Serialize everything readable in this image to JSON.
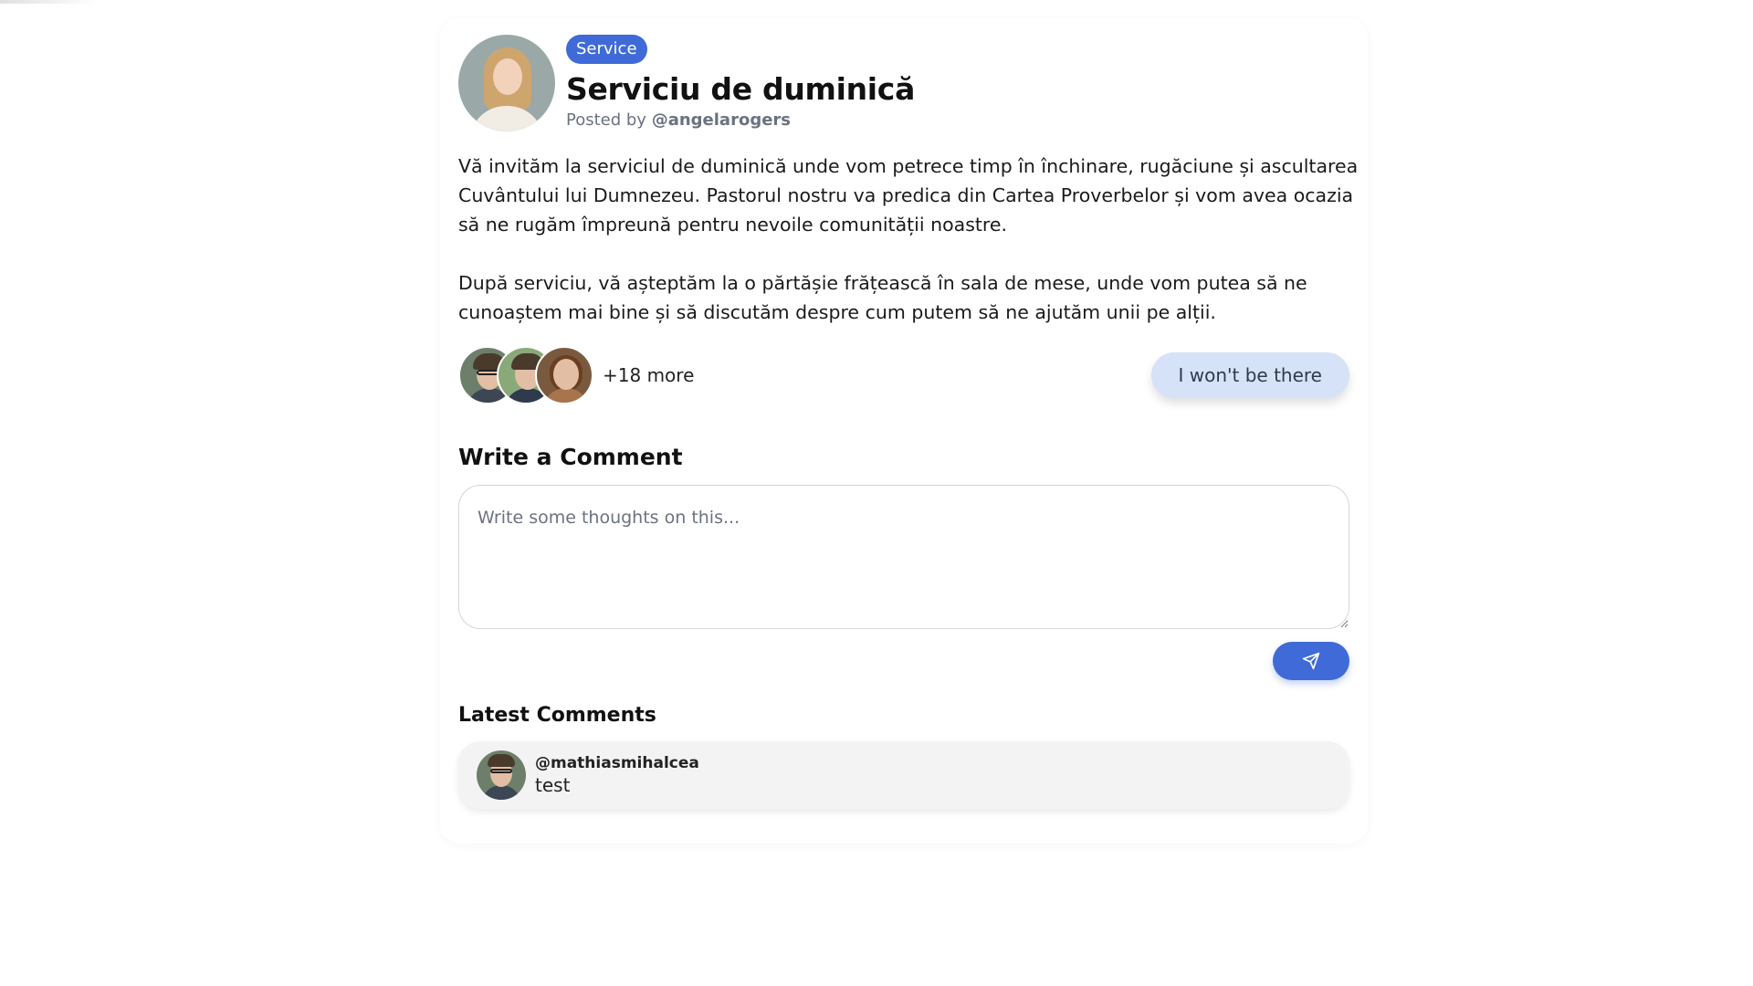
{
  "post": {
    "category_badge": "Service",
    "title": "Serviciu de duminică",
    "posted_by_prefix": "Posted by",
    "author_handle": "@angelarogers",
    "paragraphs": [
      "Vă invităm la serviciul de duminică unde vom petrece timp în închinare, rugăciune și ascultarea Cuvântului lui Dumnezeu. Pastorul nostru va predica din Cartea Proverbelor și vom avea ocazia să ne rugăm împreună pentru nevoile comunității noastre.",
      "După serviciu, vă așteptăm la o părtășie frățească în sala de mese, unde vom putea să ne cunoaștem mai bine și să discutăm despre cum putem să ne ajutăm unii pe alții."
    ]
  },
  "attendance": {
    "more_label": "+18 more",
    "rsvp_button_label": "I won't be there"
  },
  "comment_form": {
    "heading": "Write a Comment",
    "placeholder": "Write some thoughts on this...",
    "send_icon": "send-icon"
  },
  "latest_comments": {
    "heading": "Latest Comments",
    "items": [
      {
        "user": "@mathiasmihalcea",
        "text": "test"
      }
    ]
  },
  "colors": {
    "accent": "#3f6ad8",
    "rsvp_button_bg": "#d6e2f7",
    "comment_bg": "#f3f3f3"
  }
}
